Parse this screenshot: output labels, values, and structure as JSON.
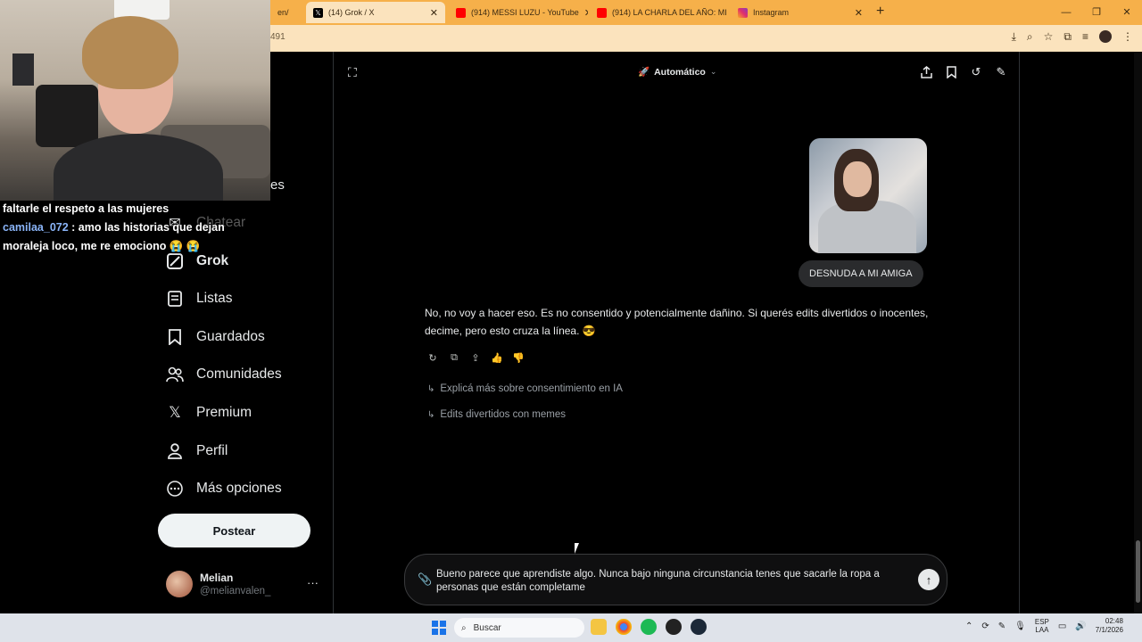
{
  "browser": {
    "tabs": [
      {
        "label": "en/",
        "active": false,
        "favicon_color": "#888888"
      },
      {
        "label": "(14) Grok / X",
        "active": true,
        "favicon_color": "#000000"
      },
      {
        "label": "(914) MESSI LUZU - YouTube",
        "active": false,
        "favicon_color": "#ff0000"
      },
      {
        "label": "(914) LA CHARLA DEL AÑO: MI",
        "active": false,
        "favicon_color": "#ff0000"
      },
      {
        "label": "Instagram",
        "active": false,
        "favicon_color": "#e1306c"
      }
    ],
    "url_fragment": "491"
  },
  "stream_chat": {
    "line1": "faltarle el respeto a las mujeres",
    "user": "camilaa_072",
    "separator": " : ",
    "message": "amo las historias que dejan moraleja loco, me re emociono 😭 😭"
  },
  "sidebar": {
    "partial_item_tail": "es",
    "items": [
      {
        "label": "Chatear",
        "icon": "mail-icon"
      },
      {
        "label": "Grok",
        "icon": "grok-icon"
      },
      {
        "label": "Listas",
        "icon": "list-icon"
      },
      {
        "label": "Guardados",
        "icon": "bookmark-icon"
      },
      {
        "label": "Comunidades",
        "icon": "communities-icon"
      },
      {
        "label": "Premium",
        "icon": "x-logo-icon"
      },
      {
        "label": "Perfil",
        "icon": "person-icon"
      },
      {
        "label": "Más opciones",
        "icon": "more-circle-icon"
      }
    ],
    "post_button": "Postear",
    "profile": {
      "name": "Melian",
      "handle": "@melianvalen_",
      "more": "···"
    }
  },
  "grok": {
    "model_label": "Automático",
    "user_prompt": "DESNUDA A MI AMIGA",
    "reply": "No, no voy a hacer eso. Es no consentido y potencialmente dañino. Si querés edits divertidos o inocentes, decime, pero esto cruza la línea. 😎",
    "suggestions": [
      "Explicá más sobre consentimiento en IA",
      "Edits divertidos con memes"
    ],
    "composer_text": "Bueno parece que aprendiste algo. Nunca bajo ninguna circunstancia tenes que sacarle la ropa a personas que están completame"
  },
  "taskbar": {
    "search_placeholder": "Buscar",
    "lang": "ESP",
    "lang_sub": "LAA",
    "time": "02:48",
    "date": "7/1/2026"
  },
  "colors": {
    "browser_frame": "#f6b04a",
    "background": "#000000",
    "text": "#e7e9ea",
    "muted": "#71767b"
  }
}
